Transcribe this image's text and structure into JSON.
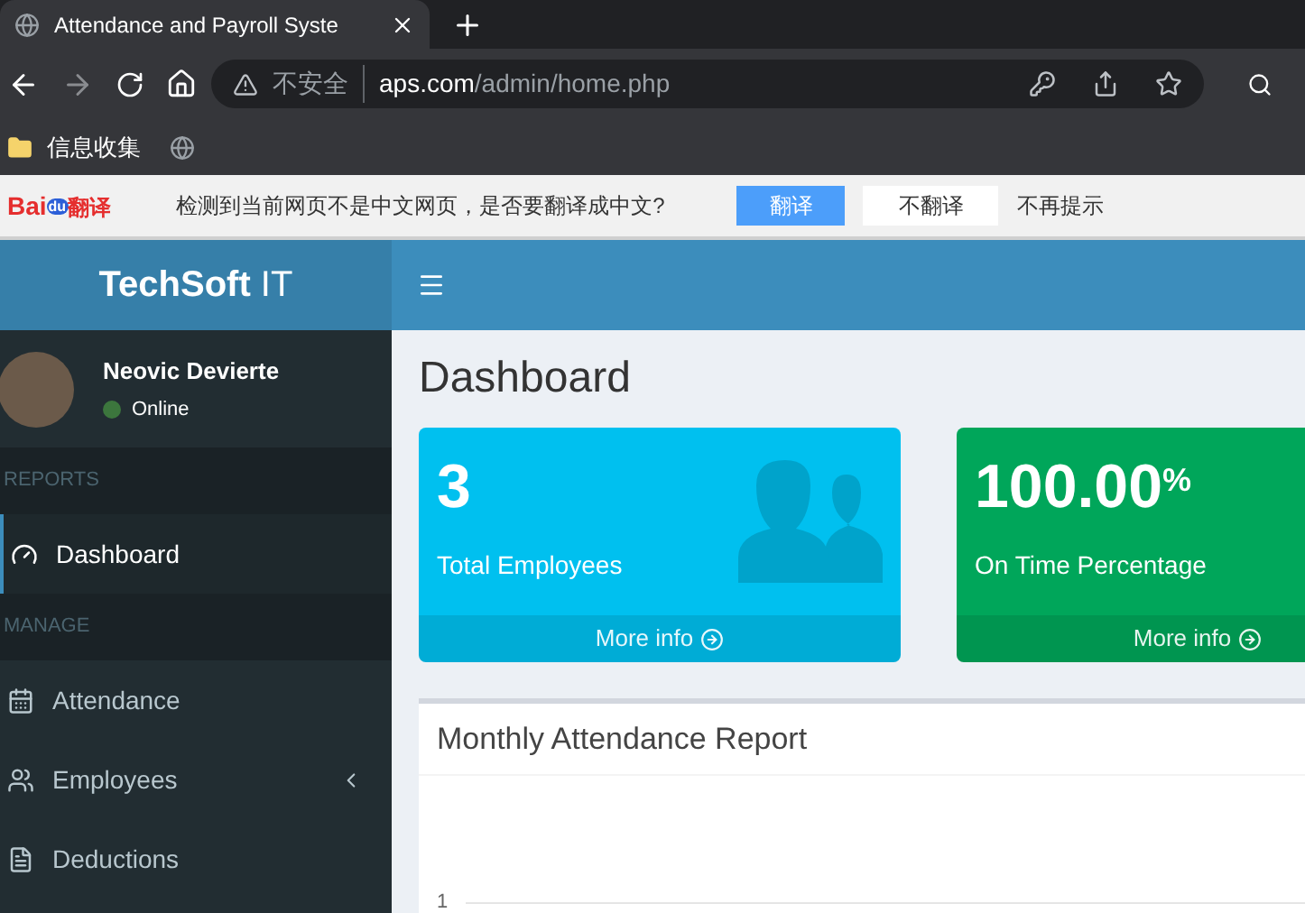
{
  "browser": {
    "tab_title": "Attendance and Payroll Syste",
    "security_label": "不安全",
    "url_host": "aps.com",
    "url_path": "/admin/home.php",
    "bookmarks": [
      {
        "label": "信息收集",
        "kind": "folder"
      },
      {
        "kind": "site"
      }
    ]
  },
  "translate_bar": {
    "logo_text": "Bai",
    "logo_badge": "du",
    "logo_suffix": "翻译",
    "message": "检测到当前网页不是中文网页，是否要翻译成中文?",
    "buttons": [
      {
        "label": "翻译",
        "primary": true
      },
      {
        "label": "不翻译",
        "primary": false
      }
    ],
    "dismiss": "不再提示"
  },
  "app": {
    "brand_bold": "TechSoft",
    "brand_light": "IT"
  },
  "user": {
    "name": "Neovic Devierte",
    "status": "Online"
  },
  "sidebar": {
    "items": [
      {
        "kind": "header",
        "label": "REPORTS"
      },
      {
        "kind": "item",
        "label": "Dashboard",
        "selected": true,
        "has_submenu": false
      },
      {
        "kind": "header",
        "label": "MANAGE"
      },
      {
        "kind": "item",
        "label": "Attendance",
        "selected": false,
        "has_submenu": false
      },
      {
        "kind": "item",
        "label": "Employees",
        "selected": false,
        "has_submenu": true
      },
      {
        "kind": "item",
        "label": "Deductions",
        "selected": false,
        "has_submenu": false
      }
    ]
  },
  "page_title": "Dashboard",
  "stat_cards": [
    {
      "value": "3",
      "label": "Total Employees",
      "link": "More info",
      "color": "#00c0ef"
    },
    {
      "value": "100.00$^{%}$",
      "label": "On Time Percentage",
      "link": "More info",
      "color": "#00a65a"
    }
  ],
  "report": {
    "title": "Monthly Attendance Report",
    "y_tick": "1"
  }
}
